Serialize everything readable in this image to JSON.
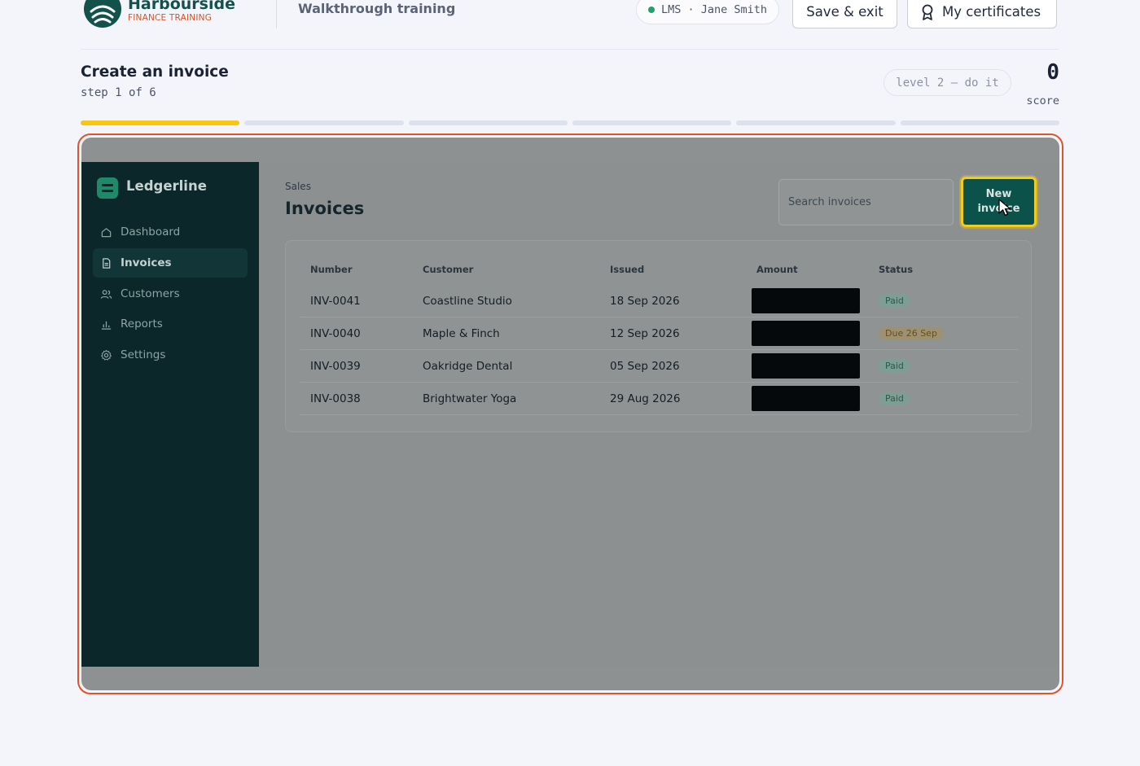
{
  "brand": {
    "name": "Harbourside",
    "subtitle": "FINANCE TRAINING"
  },
  "header": {
    "course_title": "Walkthrough training",
    "lms_pill": "LMS · Jane Smith",
    "save_exit": "Save & exit",
    "certificates": "My certificates"
  },
  "task": {
    "title": "Create an invoice",
    "step": "step 1 of 6",
    "level": "level 2 — do it",
    "score": "0",
    "score_label": "score",
    "progress": {
      "current_step": 1,
      "total_steps": 6
    }
  },
  "app": {
    "name": "Ledgerline",
    "nav": [
      {
        "label": "Dashboard",
        "icon": "home-icon",
        "active": false
      },
      {
        "label": "Invoices",
        "icon": "document-icon",
        "active": true
      },
      {
        "label": "Customers",
        "icon": "users-icon",
        "active": false
      },
      {
        "label": "Reports",
        "icon": "bar-chart-icon",
        "active": false
      },
      {
        "label": "Settings",
        "icon": "gear-icon",
        "active": false
      }
    ],
    "breadcrumb": "Sales",
    "page_title": "Invoices",
    "search_placeholder": "Search invoices",
    "new_button": "New invoice",
    "table": {
      "columns": [
        "Number",
        "Customer",
        "Issued",
        "Amount",
        "Status"
      ],
      "rows": [
        {
          "number": "INV-0041",
          "customer": "Coastline Studio",
          "issued": "18 Sep 2026",
          "status": "Paid"
        },
        {
          "number": "INV-0040",
          "customer": "Maple & Finch",
          "issued": "12 Sep 2026",
          "status": "Due 26 Sep"
        },
        {
          "number": "INV-0039",
          "customer": "Oakridge Dental",
          "issued": "05 Sep 2026",
          "status": "Paid"
        },
        {
          "number": "INV-0038",
          "customer": "Brightwater Yoga",
          "issued": "29 Aug 2026",
          "status": "Paid"
        }
      ]
    }
  },
  "colors": {
    "accent": "#f7c613",
    "frame_border": "#e0542c",
    "brand": "#12524b",
    "sidebar": "#0b272a",
    "primary_button": "#0a524a"
  }
}
